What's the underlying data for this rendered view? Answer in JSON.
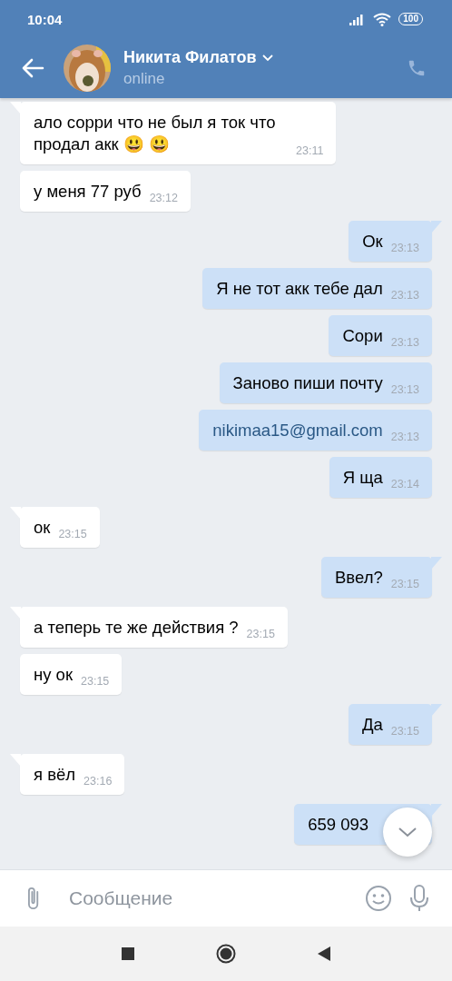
{
  "status_bar": {
    "time": "10:04",
    "battery": "100"
  },
  "header": {
    "name": "Никита Филатов",
    "status": "online"
  },
  "messages": [
    {
      "outgoing": false,
      "kind": "text",
      "tail": true,
      "text": "ало сорри что не был я ток что продал акк 😃 😃",
      "time": "23:11"
    },
    {
      "outgoing": false,
      "kind": "text",
      "tail": false,
      "text": "у меня 77 руб",
      "time": "23:12"
    },
    {
      "outgoing": true,
      "kind": "text",
      "tail": true,
      "text": "Ок",
      "time": "23:13"
    },
    {
      "outgoing": true,
      "kind": "text",
      "tail": false,
      "text": "Я не тот акк тебе дал",
      "time": "23:13"
    },
    {
      "outgoing": true,
      "kind": "text",
      "tail": false,
      "text": "Сори",
      "time": "23:13"
    },
    {
      "outgoing": true,
      "kind": "text",
      "tail": false,
      "text": "Заново пиши почту",
      "time": "23:13"
    },
    {
      "outgoing": true,
      "kind": "link",
      "tail": false,
      "text": "nikimaa15@gmail.com",
      "time": "23:13"
    },
    {
      "outgoing": true,
      "kind": "text",
      "tail": false,
      "text": "Я ща",
      "time": "23:14"
    },
    {
      "outgoing": false,
      "kind": "text",
      "tail": true,
      "text": "ок",
      "time": "23:15"
    },
    {
      "outgoing": true,
      "kind": "text",
      "tail": true,
      "text": "Ввел?",
      "time": "23:15"
    },
    {
      "outgoing": false,
      "kind": "text",
      "tail": true,
      "text": "а теперь те же действия ?",
      "time": "23:15"
    },
    {
      "outgoing": false,
      "kind": "text",
      "tail": false,
      "text": "ну ок",
      "time": "23:15"
    },
    {
      "outgoing": true,
      "kind": "text",
      "tail": true,
      "text": "Да",
      "time": "23:15"
    },
    {
      "outgoing": false,
      "kind": "text",
      "tail": true,
      "text": "я вёл",
      "time": "23:16"
    },
    {
      "outgoing": true,
      "kind": "text",
      "tail": true,
      "text": "659 093"
    }
  ],
  "composer": {
    "placeholder": "Сообщение"
  }
}
